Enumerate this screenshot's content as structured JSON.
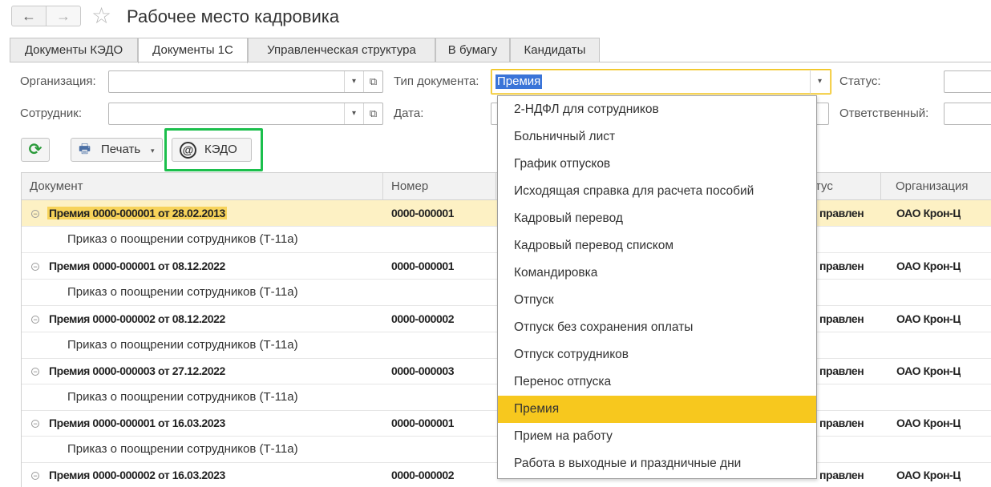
{
  "window": {
    "title": "Рабочее место кадровика",
    "back_icon": "←",
    "forward_icon": "→",
    "favorite_icon": "☆"
  },
  "tabs": [
    {
      "label": "Документы КЭДО",
      "active": false
    },
    {
      "label": "Документы 1С",
      "active": true
    },
    {
      "label": "Управленческая структура",
      "active": false
    },
    {
      "label": "В бумагу",
      "active": false
    },
    {
      "label": "Кандидаты",
      "active": false
    }
  ],
  "filters": {
    "organization_label": "Организация:",
    "organization_value": "",
    "employee_label": "Сотрудник:",
    "employee_value": "",
    "doc_type_label": "Тип документа:",
    "doc_type_value": "Премия",
    "date_label": "Дата:",
    "status_label": "Статус:",
    "responsible_label": "Ответственный:",
    "dropdown_icon": "▾",
    "open_icon": "⧉"
  },
  "toolbar": {
    "refresh_icon": "⟳",
    "print_label": "Печать",
    "print_icon": "🖶",
    "kedo_label": "КЭДО",
    "kedo_icon": "@",
    "highlight_color": "#1bbf4c"
  },
  "grid": {
    "columns": [
      "Документ",
      "Номер",
      "тус",
      "Организация"
    ],
    "rows": [
      {
        "document": "Премия 0000-000001 от 28.02.2013",
        "number": "0000-000001",
        "status": "правлен",
        "organization": "ОАО Крон-Ц",
        "child": "Приказ о поощрении сотрудников (Т-11а)",
        "selected": true
      },
      {
        "document": "Премия 0000-000001 от 08.12.2022",
        "number": "0000-000001",
        "status": "правлен",
        "organization": "ОАО Крон-Ц",
        "child": "Приказ о поощрении сотрудников (Т-11а)",
        "selected": false
      },
      {
        "document": "Премия 0000-000002 от 08.12.2022",
        "number": "0000-000002",
        "status": "правлен",
        "organization": "ОАО Крон-Ц",
        "child": "Приказ о поощрении сотрудников (Т-11а)",
        "selected": false
      },
      {
        "document": "Премия 0000-000003 от 27.12.2022",
        "number": "0000-000003",
        "status": "правлен",
        "organization": "ОАО Крон-Ц",
        "child": "Приказ о поощрении сотрудников (Т-11а)",
        "selected": false
      },
      {
        "document": "Премия 0000-000001 от 16.03.2023",
        "number": "0000-000001",
        "status": "правлен",
        "organization": "ОАО Крон-Ц",
        "child": "Приказ о поощрении сотрудников (Т-11а)",
        "selected": false
      },
      {
        "document": "Премия 0000-000002 от 16.03.2023",
        "number": "0000-000002",
        "status": "правлен",
        "organization": "ОАО Крон-Ц",
        "child": "",
        "selected": false
      }
    ],
    "collapse_icon": "−"
  },
  "doc_type_dropdown": {
    "items": [
      "2-НДФЛ для сотрудников",
      "Больничный лист",
      "График отпусков",
      "Исходящая справка для расчета пособий",
      "Кадровый перевод",
      "Кадровый перевод списком",
      "Командировка",
      "Отпуск",
      "Отпуск без сохранения оплаты",
      "Отпуск сотрудников",
      "Перенос отпуска",
      "Премия",
      "Прием на работу",
      "Работа в выходные и праздничные дни"
    ],
    "selected": "Премия",
    "highlight_color": "#f7c81e"
  }
}
